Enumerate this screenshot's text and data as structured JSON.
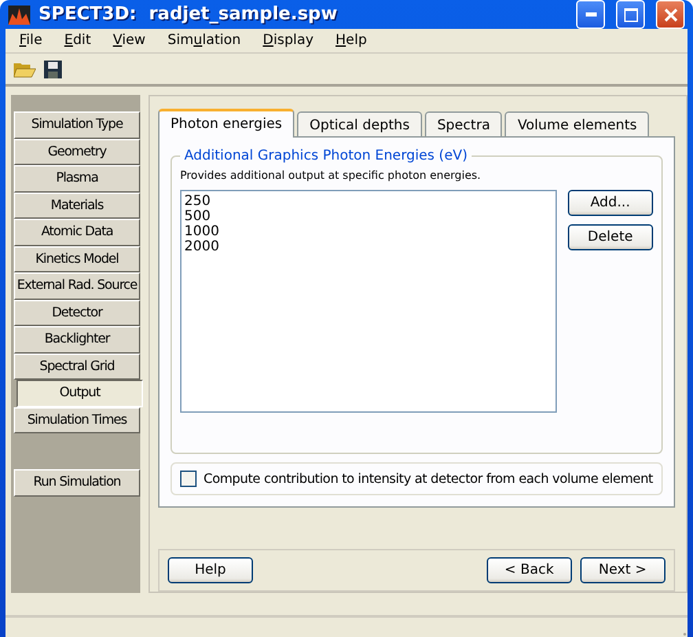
{
  "window": {
    "title": "SPECT3D:  radjet_sample.spw"
  },
  "menu": [
    {
      "access_key": "F",
      "rest": "ile"
    },
    {
      "access_key": "E",
      "rest": "dit"
    },
    {
      "access_key": "V",
      "rest": "iew"
    },
    {
      "before": "Sim",
      "access_key": "u",
      "rest": "lation"
    },
    {
      "access_key": "D",
      "rest": "isplay"
    },
    {
      "access_key": "H",
      "rest": "elp"
    }
  ],
  "sidebar": {
    "items": [
      {
        "label": "Simulation Type",
        "selected": false
      },
      {
        "label": "Geometry",
        "selected": false
      },
      {
        "label": "Plasma",
        "selected": false
      },
      {
        "label": "Materials",
        "selected": false
      },
      {
        "label": "Atomic Data",
        "selected": false
      },
      {
        "label": "Kinetics Model",
        "selected": false
      },
      {
        "label": "External Rad. Source",
        "selected": false
      },
      {
        "label": "Detector",
        "selected": false
      },
      {
        "label": "Backlighter",
        "selected": false
      },
      {
        "label": "Spectral Grid",
        "selected": false
      },
      {
        "label": "Output",
        "selected": true
      },
      {
        "label": "Simulation Times",
        "selected": false
      }
    ],
    "run_button": "Run Simulation"
  },
  "tabs": [
    {
      "label": "Photon energies",
      "selected": true
    },
    {
      "label": "Optical depths",
      "selected": false
    },
    {
      "label": "Spectra",
      "selected": false
    },
    {
      "label": "Volume elements",
      "selected": false
    }
  ],
  "group": {
    "title": "Additional Graphics Photon Energies (eV)",
    "description": "Provides additional output at specific photon energies.",
    "energies": [
      "250",
      "500",
      "1000",
      "2000"
    ],
    "buttons": [
      "Add...",
      "Delete"
    ]
  },
  "checkbox": {
    "label": "Compute contribution to intensity at detector from each volume element",
    "checked": false
  },
  "nav": {
    "help": "Help",
    "back": "< Back",
    "next": "Next >"
  }
}
